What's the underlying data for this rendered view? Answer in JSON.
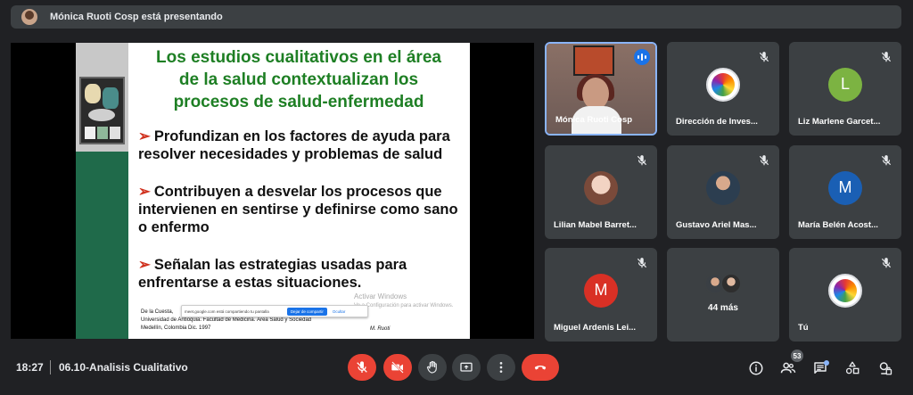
{
  "banner": {
    "text": "Mónica Ruoti Cosp está presentando"
  },
  "slide": {
    "title_lines": [
      "Los estudios cualitativos en el área",
      "de la salud contextualizan los",
      "procesos de salud-enfermedad"
    ],
    "bullets": [
      "Profundizan en los factores de ayuda para resolver necesidades y problemas de salud",
      "Contribuyen a desvelar los procesos que intervienen en sentirse y definirse como sano o enfermo",
      "Señalan las estrategias usadas para enfrentarse a estas situaciones."
    ],
    "citation": [
      "De la Cuesta,",
      "Universidad de Antioquia. Facultad de Medicina. Área Salud y Sociedad",
      "Medellín, Colombia Dic. 1997"
    ],
    "share_bar": {
      "text": "meet.google.com está compartiendo tu pantalla",
      "stop": "Dejar de compartir",
      "hide": "Ocultar"
    },
    "watermark": "Activar Windows",
    "watermark_sub": "Ve a Configuración para activar Windows.",
    "signature": "M. Ruoti"
  },
  "participants": [
    {
      "name": "Mónica Ruoti Cosp",
      "kind": "camera",
      "speaking": true
    },
    {
      "name": "Dirección de Inves...",
      "kind": "logo",
      "muted": true
    },
    {
      "name": "Liz Marlene Garcet...",
      "kind": "initial",
      "initial": "L",
      "color": "#7cb342",
      "muted": true
    },
    {
      "name": "Lilian Mabel Barret...",
      "kind": "photo",
      "color": "#d6b4a4",
      "muted": true
    },
    {
      "name": "Gustavo Ariel Mas...",
      "kind": "photo",
      "color": "#55606a",
      "muted": true
    },
    {
      "name": "María Belén Acost...",
      "kind": "initial",
      "initial": "M",
      "color": "#1a5fb4",
      "muted": true
    },
    {
      "name": "Miguel Ardenis Lei...",
      "kind": "initial",
      "initial": "M",
      "color": "#d93025",
      "muted": true
    },
    {
      "name": "",
      "kind": "more",
      "more_label": "44 más"
    },
    {
      "name": "Tú",
      "kind": "logo",
      "muted": true
    }
  ],
  "bottom": {
    "time": "18:27",
    "meeting": "06.10-Analisis Cualitativo",
    "people_count": "53",
    "colors": {
      "danger": "#ea4335",
      "control": "#3c4043",
      "accent": "#8ab4f8"
    },
    "controls": [
      "mic-off-icon",
      "camera-off-icon",
      "raise-hand-icon",
      "present-icon",
      "more-options-icon",
      "hang-up-icon"
    ],
    "right_icons": [
      "info-icon",
      "people-icon",
      "chat-icon",
      "activities-icon",
      "host-controls-icon"
    ]
  }
}
